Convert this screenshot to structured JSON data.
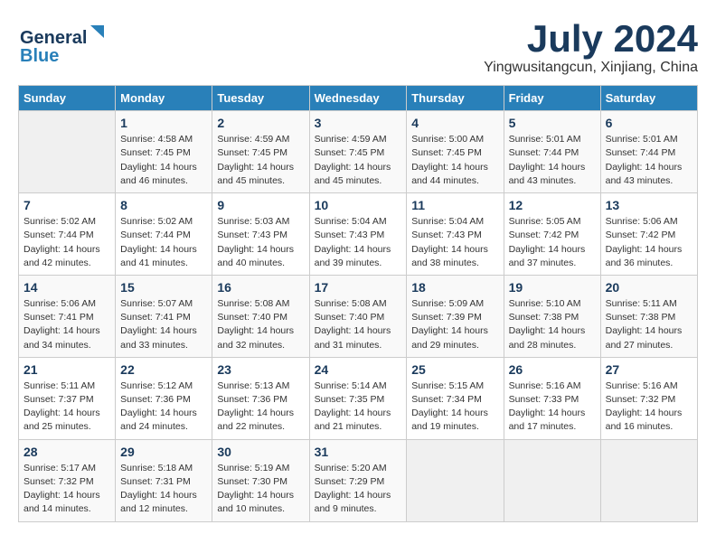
{
  "logo": {
    "line1": "General",
    "line2": "Blue"
  },
  "title": "July 2024",
  "subtitle": "Yingwusitangcun, Xinjiang, China",
  "columns": [
    "Sunday",
    "Monday",
    "Tuesday",
    "Wednesday",
    "Thursday",
    "Friday",
    "Saturday"
  ],
  "weeks": [
    [
      {
        "day": "",
        "info": ""
      },
      {
        "day": "1",
        "info": "Sunrise: 4:58 AM\nSunset: 7:45 PM\nDaylight: 14 hours\nand 46 minutes."
      },
      {
        "day": "2",
        "info": "Sunrise: 4:59 AM\nSunset: 7:45 PM\nDaylight: 14 hours\nand 45 minutes."
      },
      {
        "day": "3",
        "info": "Sunrise: 4:59 AM\nSunset: 7:45 PM\nDaylight: 14 hours\nand 45 minutes."
      },
      {
        "day": "4",
        "info": "Sunrise: 5:00 AM\nSunset: 7:45 PM\nDaylight: 14 hours\nand 44 minutes."
      },
      {
        "day": "5",
        "info": "Sunrise: 5:01 AM\nSunset: 7:44 PM\nDaylight: 14 hours\nand 43 minutes."
      },
      {
        "day": "6",
        "info": "Sunrise: 5:01 AM\nSunset: 7:44 PM\nDaylight: 14 hours\nand 43 minutes."
      }
    ],
    [
      {
        "day": "7",
        "info": "Sunrise: 5:02 AM\nSunset: 7:44 PM\nDaylight: 14 hours\nand 42 minutes."
      },
      {
        "day": "8",
        "info": "Sunrise: 5:02 AM\nSunset: 7:44 PM\nDaylight: 14 hours\nand 41 minutes."
      },
      {
        "day": "9",
        "info": "Sunrise: 5:03 AM\nSunset: 7:43 PM\nDaylight: 14 hours\nand 40 minutes."
      },
      {
        "day": "10",
        "info": "Sunrise: 5:04 AM\nSunset: 7:43 PM\nDaylight: 14 hours\nand 39 minutes."
      },
      {
        "day": "11",
        "info": "Sunrise: 5:04 AM\nSunset: 7:43 PM\nDaylight: 14 hours\nand 38 minutes."
      },
      {
        "day": "12",
        "info": "Sunrise: 5:05 AM\nSunset: 7:42 PM\nDaylight: 14 hours\nand 37 minutes."
      },
      {
        "day": "13",
        "info": "Sunrise: 5:06 AM\nSunset: 7:42 PM\nDaylight: 14 hours\nand 36 minutes."
      }
    ],
    [
      {
        "day": "14",
        "info": "Sunrise: 5:06 AM\nSunset: 7:41 PM\nDaylight: 14 hours\nand 34 minutes."
      },
      {
        "day": "15",
        "info": "Sunrise: 5:07 AM\nSunset: 7:41 PM\nDaylight: 14 hours\nand 33 minutes."
      },
      {
        "day": "16",
        "info": "Sunrise: 5:08 AM\nSunset: 7:40 PM\nDaylight: 14 hours\nand 32 minutes."
      },
      {
        "day": "17",
        "info": "Sunrise: 5:08 AM\nSunset: 7:40 PM\nDaylight: 14 hours\nand 31 minutes."
      },
      {
        "day": "18",
        "info": "Sunrise: 5:09 AM\nSunset: 7:39 PM\nDaylight: 14 hours\nand 29 minutes."
      },
      {
        "day": "19",
        "info": "Sunrise: 5:10 AM\nSunset: 7:38 PM\nDaylight: 14 hours\nand 28 minutes."
      },
      {
        "day": "20",
        "info": "Sunrise: 5:11 AM\nSunset: 7:38 PM\nDaylight: 14 hours\nand 27 minutes."
      }
    ],
    [
      {
        "day": "21",
        "info": "Sunrise: 5:11 AM\nSunset: 7:37 PM\nDaylight: 14 hours\nand 25 minutes."
      },
      {
        "day": "22",
        "info": "Sunrise: 5:12 AM\nSunset: 7:36 PM\nDaylight: 14 hours\nand 24 minutes."
      },
      {
        "day": "23",
        "info": "Sunrise: 5:13 AM\nSunset: 7:36 PM\nDaylight: 14 hours\nand 22 minutes."
      },
      {
        "day": "24",
        "info": "Sunrise: 5:14 AM\nSunset: 7:35 PM\nDaylight: 14 hours\nand 21 minutes."
      },
      {
        "day": "25",
        "info": "Sunrise: 5:15 AM\nSunset: 7:34 PM\nDaylight: 14 hours\nand 19 minutes."
      },
      {
        "day": "26",
        "info": "Sunrise: 5:16 AM\nSunset: 7:33 PM\nDaylight: 14 hours\nand 17 minutes."
      },
      {
        "day": "27",
        "info": "Sunrise: 5:16 AM\nSunset: 7:32 PM\nDaylight: 14 hours\nand 16 minutes."
      }
    ],
    [
      {
        "day": "28",
        "info": "Sunrise: 5:17 AM\nSunset: 7:32 PM\nDaylight: 14 hours\nand 14 minutes."
      },
      {
        "day": "29",
        "info": "Sunrise: 5:18 AM\nSunset: 7:31 PM\nDaylight: 14 hours\nand 12 minutes."
      },
      {
        "day": "30",
        "info": "Sunrise: 5:19 AM\nSunset: 7:30 PM\nDaylight: 14 hours\nand 10 minutes."
      },
      {
        "day": "31",
        "info": "Sunrise: 5:20 AM\nSunset: 7:29 PM\nDaylight: 14 hours\nand 9 minutes."
      },
      {
        "day": "",
        "info": ""
      },
      {
        "day": "",
        "info": ""
      },
      {
        "day": "",
        "info": ""
      }
    ]
  ]
}
